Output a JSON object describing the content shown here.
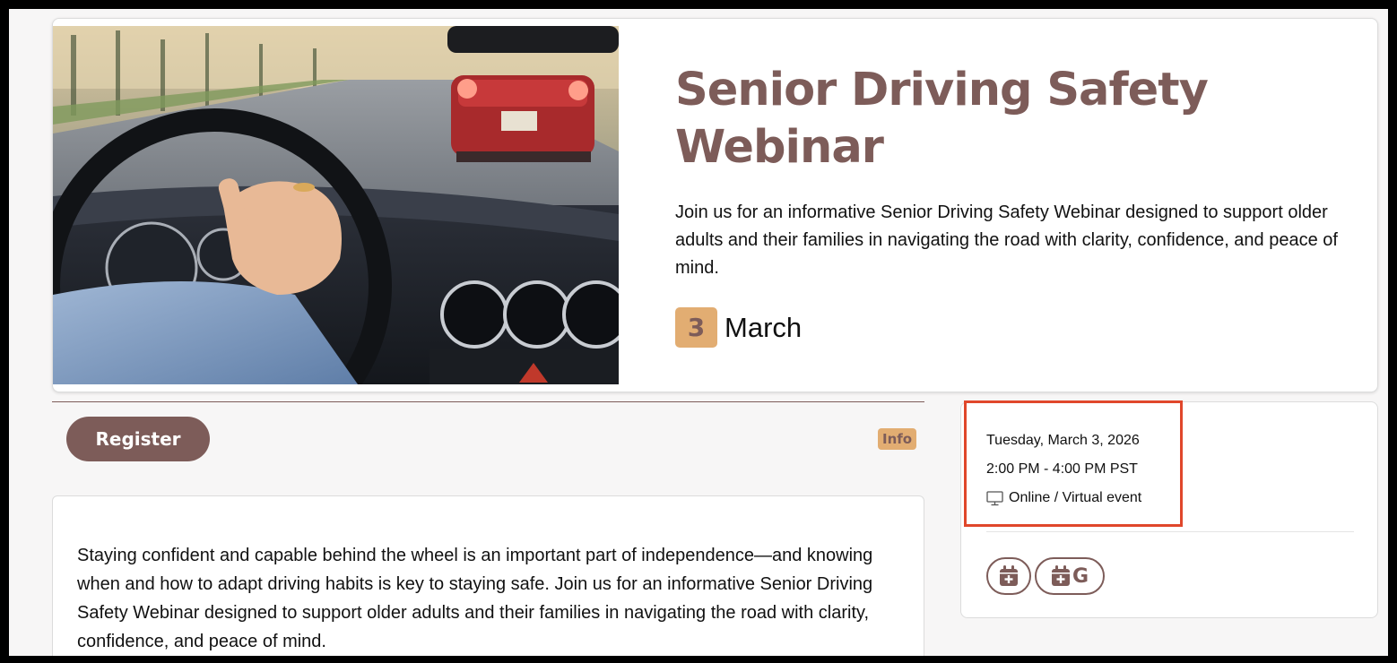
{
  "hero": {
    "title": "Senior Driving Safety Webinar",
    "description": "Join us for an informative Senior Driving Safety Webinar designed to support older adults and their families in navigating the road with clarity, confidence, and peace of mind.",
    "day": "3",
    "month": "March",
    "image_icon": "car-interior-photo"
  },
  "actions": {
    "register_label": "Register",
    "info_label": "Info"
  },
  "body": {
    "paragraph": "Staying confident and capable behind the wheel is an important part of independence—and knowing when and how to adapt driving habits is key to staying safe. Join us for an informative Senior Driving Safety Webinar designed to support older adults and their families in navigating the road with clarity, confidence, and peace of mind."
  },
  "event": {
    "date": "Tuesday, March 3, 2026",
    "time": "2:00 PM - 4:00 PM PST",
    "location": "Online / Virtual event",
    "location_icon": "monitor-icon",
    "add_calendar_icon": "calendar-plus-icon",
    "google_calendar_letter": "G"
  },
  "colors": {
    "brand": "#7d5c59",
    "accent": "#e2ad72",
    "highlight": "#e0472b"
  }
}
